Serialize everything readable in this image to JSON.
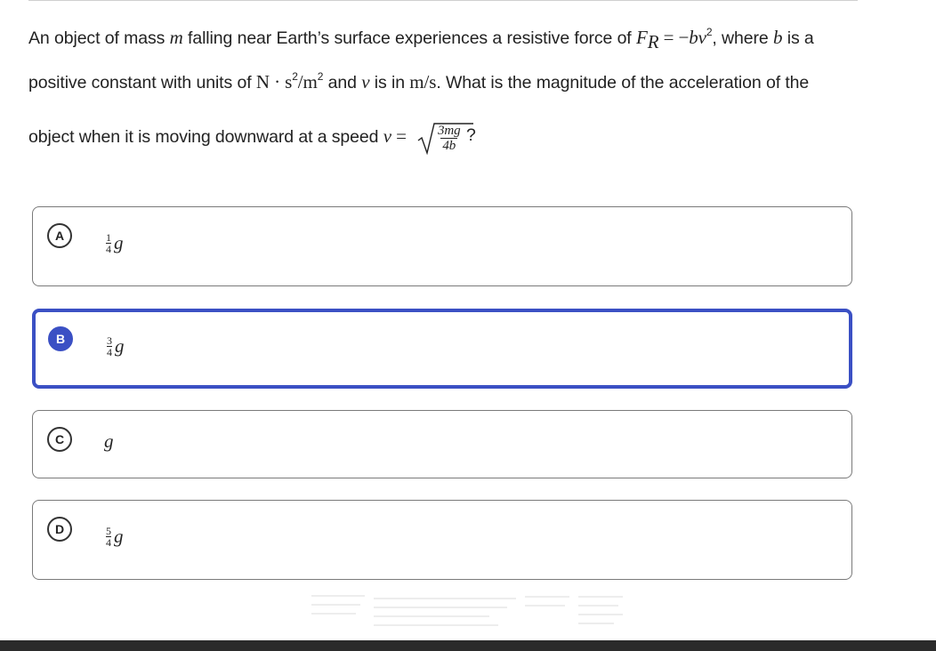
{
  "question": {
    "line1": {
      "t1": "An object of mass ",
      "m": "m",
      "t2": " falling near Earth’s surface experiences a resistive force of ",
      "F": "F",
      "R": "R",
      "eq": " = −",
      "bv": "bv",
      "sq": "2",
      "t3": ", where ",
      "b": "b",
      "t4": " is a"
    },
    "line2": {
      "t1": "positive constant with units of ",
      "N": "N · s",
      "s2": "2",
      "slash": "/m",
      "m2": "2",
      "t2": " and ",
      "v": "v",
      "t3": " is in ",
      "ms": "m/s",
      "t4": ". What is the magnitude of the acceleration of the"
    },
    "line3": {
      "t1": "object when it is moving downward at a speed ",
      "v": "v",
      "eq": " = ",
      "num": "3mg",
      "den": "4b",
      "q": "?"
    }
  },
  "choices": [
    {
      "letter": "A",
      "num": "1",
      "den": "4",
      "var": "g",
      "selected": false
    },
    {
      "letter": "B",
      "num": "3",
      "den": "4",
      "var": "g",
      "selected": true
    },
    {
      "letter": "C",
      "num": "",
      "den": "",
      "var": "g",
      "selected": false
    },
    {
      "letter": "D",
      "num": "5",
      "den": "4",
      "var": "g",
      "selected": false
    }
  ],
  "colors": {
    "selected": "#3b50c4",
    "border": "#7a7a7a",
    "bottom_bar": "#2b2b2b"
  }
}
